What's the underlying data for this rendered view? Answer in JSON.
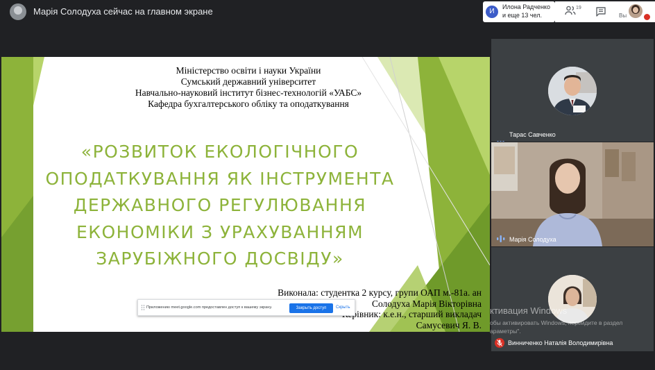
{
  "header": {
    "presenter_title": "Марія Солодуха сейчас на главном экране"
  },
  "participants": {
    "avatar_letter": "И",
    "line1": "Илона Радченко",
    "line2": "и еще 13 чел.",
    "count": "19"
  },
  "self": {
    "label": "Вы"
  },
  "slide": {
    "institution_lines": [
      "Міністерство освіти і науки України",
      "Сумський державний університет",
      "Навчально-науковий інститут бізнес-технологій «УАБС»",
      "Кафедра бухгалтерського обліку та оподаткування"
    ],
    "title_lines": [
      "«РОЗВИТОК ЕКОЛОГІЧНОГО",
      "ОПОДАТКУВАННЯ ЯК ІНСТРУМЕНТА",
      "ДЕРЖАВНОГО РЕГУЛЮВАННЯ",
      "ЕКОНОМІКИ З УРАХУВАННЯМ",
      "ЗАРУБІЖНОГО ДОСВІДУ»"
    ],
    "author_lines": [
      "Виконала: студентка 2 курсу, групи ОАП м.-81а. ан",
      "Солодуха Марія Вікторівна",
      "Керівник: к.е.н., старший викладач",
      "Самусевич Я. В."
    ],
    "accent_color": "#8db33a"
  },
  "share_notice": {
    "text": "Приложению meet.google.com предоставлен доступ к вашему экрану.",
    "stop_label": "Закрыть доступ",
    "hide_label": "Скрыть"
  },
  "tiles": [
    {
      "name": "Тарас Савченко",
      "status": "dots"
    },
    {
      "name": "Марія Солодуха",
      "status": "speaking"
    },
    {
      "name": "Винниченко Наталія Володимирівна",
      "status": "muted"
    }
  ],
  "watermark": {
    "line1": "ктивация Windows",
    "line2": "обы активировать Windows, перейдите в раздел",
    "line3": "араметры\"."
  }
}
